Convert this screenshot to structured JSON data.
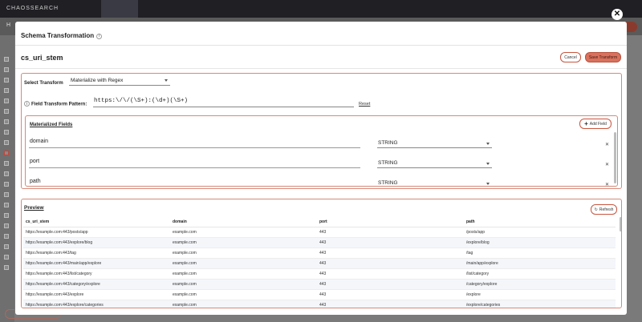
{
  "background": {
    "brand": "CHAOSSEARCH",
    "home": "H"
  },
  "modal": {
    "title": "Schema Transformation",
    "field_name": "cs_uri_stem",
    "cancel_label": "Cancel",
    "save_label": "Save Transform"
  },
  "transform": {
    "select_label": "Select Transform",
    "selected": "Materialize with Regex",
    "pattern_label": "Field Transform Pattern:",
    "pattern_value": "https:\\/\\/(\\S+):(\\d+)(\\S+)",
    "reset_label": "Reset"
  },
  "materialized": {
    "title": "Materialized Fields",
    "add_label": "Add Field",
    "fields": [
      {
        "name": "domain",
        "type": "STRING"
      },
      {
        "name": "port",
        "type": "STRING"
      },
      {
        "name": "path",
        "type": "STRING"
      }
    ]
  },
  "preview": {
    "title": "Preview",
    "refresh_label": "Refresh",
    "columns": [
      "cs_uri_stem",
      "domain",
      "port",
      "path"
    ],
    "rows": [
      [
        "https://example.com:443/posts/app",
        "example.com",
        "443",
        "/posts/app"
      ],
      [
        "https://example.com:443/explore/blog",
        "example.com",
        "443",
        "/explore/blog"
      ],
      [
        "https://example.com:443/tag",
        "example.com",
        "443",
        "/tag"
      ],
      [
        "https://example.com:443/main/app/explore",
        "example.com",
        "443",
        "/main/app/explore"
      ],
      [
        "https://example.com:443/list/category",
        "example.com",
        "443",
        "/list/category"
      ],
      [
        "https://example.com:443/category/explore",
        "example.com",
        "443",
        "/category/explore"
      ],
      [
        "https://example.com:443/explore",
        "example.com",
        "443",
        "/explore"
      ],
      [
        "https://example.com:443/explore/categories",
        "example.com",
        "443",
        "/explore/categories"
      ]
    ]
  }
}
